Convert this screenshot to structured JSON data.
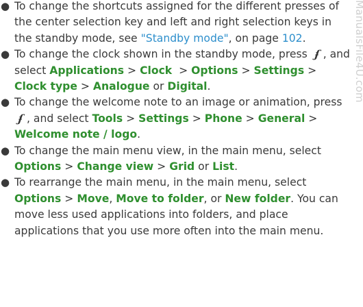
{
  "watermark": "ManualsFile4U.com",
  "icons": {
    "menu_key": "menu-key-icon",
    "bullet": "bullet-dot"
  },
  "items": [
    {
      "text1": "To change the shortcuts assigned for the different presses of the center selection key and left and right selection keys in the standby mode, see ",
      "link": "\"Standby mode\"",
      "text2": ", on page ",
      "page": "102",
      "end": "."
    },
    {
      "text1": "To change the clock shown in the standby mode, press ",
      "text2": ", and select ",
      "path": [
        "Applications",
        "Clock",
        "Options",
        "Settings",
        "Clock type",
        "Analogue"
      ],
      "or": "or",
      "last": "Digital",
      "end": "."
    },
    {
      "text1": "To change the welcome note to an image or animation, press ",
      "text2": ", and select ",
      "path": [
        "Tools",
        "Settings",
        "Phone",
        "General",
        "Welcome note / logo"
      ],
      "end": "."
    },
    {
      "text1": "To change the main menu view, in the main menu, select ",
      "path": [
        "Options",
        "Change view",
        "Grid"
      ],
      "or": "or",
      "last": "List",
      "end": "."
    },
    {
      "text1": "To rearrange the main menu, in the main menu, select ",
      "path": [
        "Options",
        "Move"
      ],
      "opt2": "Move to folder",
      "or": ", or",
      "last": "New folder",
      "text2": ". You can move less used applications into folders, and place applications that you use more often into the main menu."
    }
  ]
}
